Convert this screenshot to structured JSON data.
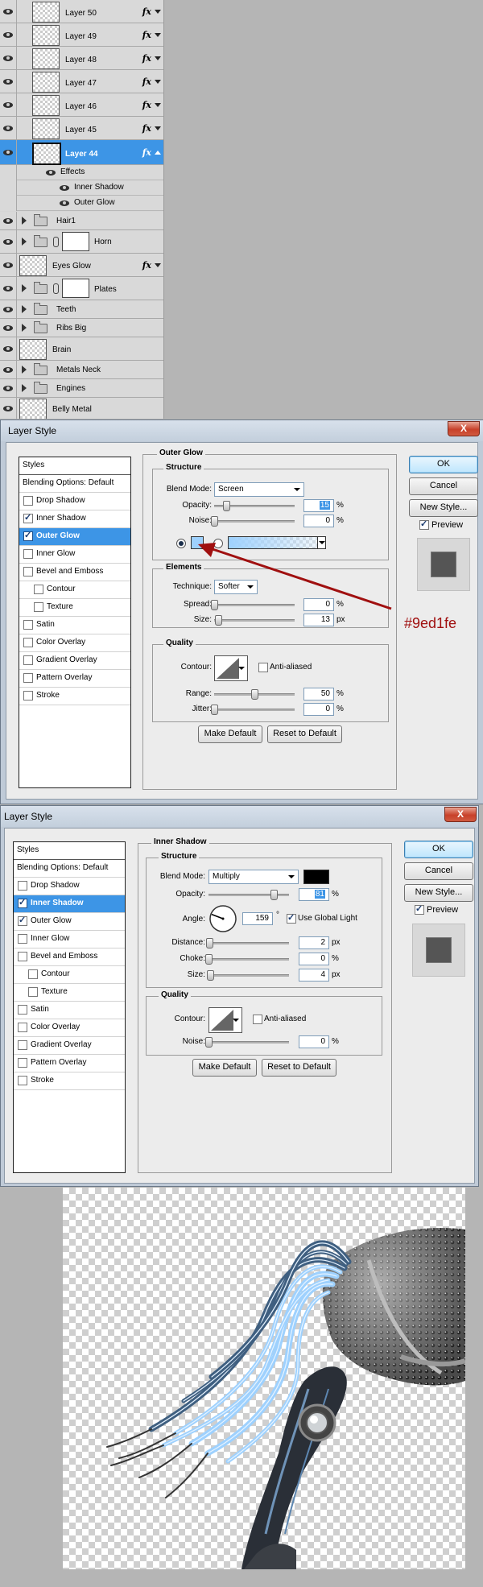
{
  "layers_panel": {
    "layers": [
      {
        "name": "Layer 50",
        "fx": "fx"
      },
      {
        "name": "Layer 49",
        "fx": "fx"
      },
      {
        "name": "Layer 48",
        "fx": "fx"
      },
      {
        "name": "Layer 47",
        "fx": "fx"
      },
      {
        "name": "Layer 46",
        "fx": "fx"
      },
      {
        "name": "Layer 45",
        "fx": "fx"
      },
      {
        "name": "Layer 44",
        "fx": "fx",
        "selected": true
      }
    ],
    "effects": {
      "label": "Effects",
      "items": [
        "Inner Shadow",
        "Outer Glow"
      ]
    },
    "lower_layers": [
      {
        "name": "Hair1",
        "type": "group"
      },
      {
        "name": "Horn",
        "type": "group-mask"
      },
      {
        "name": "Eyes Glow",
        "type": "layer",
        "fx": "fx"
      },
      {
        "name": "Plates",
        "type": "group-mask"
      },
      {
        "name": "Teeth",
        "type": "group"
      },
      {
        "name": "Ribs Big",
        "type": "group"
      },
      {
        "name": "Brain",
        "type": "layer"
      },
      {
        "name": "Metals Neck",
        "type": "group"
      },
      {
        "name": "Engines",
        "type": "group"
      },
      {
        "name": "Belly Metal",
        "type": "layer"
      }
    ]
  },
  "dialog_outer_glow": {
    "title": "Layer Style",
    "close": "X",
    "styles_list": [
      "Styles",
      "Blending Options: Default",
      "Drop Shadow",
      "Inner Shadow",
      "Outer Glow",
      "Inner Glow",
      "Bevel and Emboss",
      "Contour",
      "Texture",
      "Satin",
      "Color Overlay",
      "Gradient Overlay",
      "Pattern Overlay",
      "Stroke"
    ],
    "checked": [
      false,
      false,
      false,
      true,
      true,
      false,
      false,
      false,
      false,
      false,
      false,
      false,
      false,
      false
    ],
    "section_title": "Outer Glow",
    "structure": {
      "legend": "Structure",
      "blend_mode_label": "Blend Mode:",
      "blend_mode_value": "Screen",
      "opacity_label": "Opacity:",
      "opacity_value": "15",
      "opacity_level": 15,
      "noise_label": "Noise:",
      "noise_value": "0",
      "noise_level": 0,
      "percent": "%",
      "glow_color": "#9ed1fe"
    },
    "elements": {
      "legend": "Elements",
      "technique_label": "Technique:",
      "technique_value": "Softer",
      "spread_label": "Spread:",
      "spread_value": "0",
      "spread_level": 0,
      "size_label": "Size:",
      "size_value": "13",
      "size_level": 13,
      "px": "px",
      "percent": "%"
    },
    "quality": {
      "legend": "Quality",
      "contour_label": "Contour:",
      "anti_aliased": "Anti-aliased",
      "range_label": "Range:",
      "range_value": "50",
      "range_level": 50,
      "jitter_label": "Jitter:",
      "jitter_value": "0",
      "jitter_level": 0,
      "percent": "%"
    },
    "make_default": "Make Default",
    "reset_default": "Reset to Default",
    "ok": "OK",
    "cancel": "Cancel",
    "new_style": "New Style...",
    "preview": "Preview"
  },
  "annotation": {
    "text": "#9ed1fe",
    "color": "#a01010"
  },
  "dialog_inner_shadow": {
    "title": "Layer Style",
    "close": "X",
    "styles_list": [
      "Styles",
      "Blending Options: Default",
      "Drop Shadow",
      "Inner Shadow",
      "Outer Glow",
      "Inner Glow",
      "Bevel and Emboss",
      "Contour",
      "Texture",
      "Satin",
      "Color Overlay",
      "Gradient Overlay",
      "Pattern Overlay",
      "Stroke"
    ],
    "checked": [
      false,
      false,
      false,
      true,
      true,
      false,
      false,
      false,
      false,
      false,
      false,
      false,
      false,
      false
    ],
    "section_title": "Inner Shadow",
    "structure": {
      "legend": "Structure",
      "blend_mode_label": "Blend Mode:",
      "blend_mode_value": "Multiply",
      "shadow_color": "#000000",
      "opacity_label": "Opacity:",
      "opacity_value": "81",
      "opacity_level": 81,
      "angle_label": "Angle:",
      "angle_value": "159",
      "degree": "°",
      "use_global_light": "Use Global Light",
      "distance_label": "Distance:",
      "distance_value": "2",
      "distance_level": 2,
      "choke_label": "Choke:",
      "choke_value": "0",
      "choke_level": 0,
      "size_label": "Size:",
      "size_value": "4",
      "size_level": 4,
      "px": "px",
      "percent": "%"
    },
    "quality": {
      "legend": "Quality",
      "contour_label": "Contour:",
      "anti_aliased": "Anti-aliased",
      "noise_label": "Noise:",
      "noise_value": "0",
      "noise_level": 0,
      "percent": "%"
    },
    "make_default": "Make Default",
    "reset_default": "Reset to Default",
    "ok": "OK",
    "cancel": "Cancel",
    "new_style": "New Style...",
    "preview": "Preview"
  },
  "canvas": {
    "hair_color": "#9ed1fe"
  }
}
